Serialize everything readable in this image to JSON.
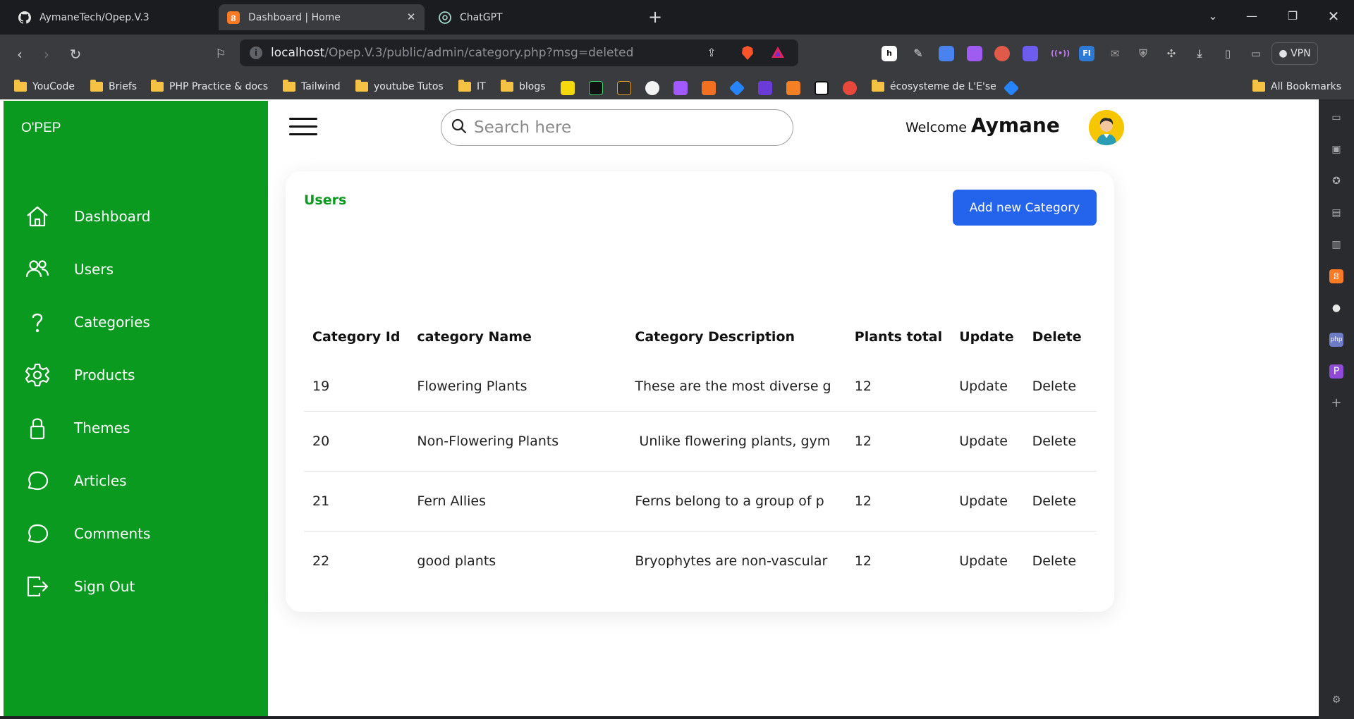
{
  "browser": {
    "tabs": [
      {
        "title": "AymaneTech/Opep.V.3",
        "icon": "github-icon",
        "active": false
      },
      {
        "title": "Dashboard | Home",
        "icon": "xampp-icon",
        "active": true
      },
      {
        "title": "ChatGPT",
        "icon": "chatgpt-icon",
        "active": false
      }
    ],
    "url": {
      "host": "localhost",
      "path": "/Opep.V.3/public/admin/category.php?msg=deleted"
    },
    "vpn_label": "VPN",
    "bookmarks": [
      "YouCode",
      "Briefs",
      "PHP Practice & docs",
      "Tailwind",
      "youtube Tutos",
      "IT",
      "blogs",
      "écosysteme de L'E'se"
    ],
    "all_bookmarks": "All Bookmarks"
  },
  "sidebar": {
    "brand": "O'PEP",
    "items": [
      {
        "label": "Dashboard",
        "icon": "home-icon"
      },
      {
        "label": "Users",
        "icon": "users-icon"
      },
      {
        "label": "Categories",
        "icon": "question-icon"
      },
      {
        "label": "Products",
        "icon": "gear-icon"
      },
      {
        "label": "Themes",
        "icon": "lock-icon"
      },
      {
        "label": "Articles",
        "icon": "chat-bubble-icon"
      },
      {
        "label": "Comments",
        "icon": "chat-bubble-icon"
      },
      {
        "label": "Sign Out",
        "icon": "sign-out-icon"
      }
    ]
  },
  "header": {
    "search_placeholder": "Search here",
    "welcome_text": "Welcome",
    "user_name": "Aymane"
  },
  "card": {
    "title": "Users",
    "add_button": "Add new Category",
    "columns": [
      "Category Id",
      "category Name",
      "Category Description",
      "Plants total",
      "Update",
      "Delete"
    ],
    "rows": [
      {
        "id": "19",
        "name": "Flowering Plants",
        "description": "These are the most diverse g",
        "total": "12",
        "update": "Update",
        "delete": "Delete"
      },
      {
        "id": "20",
        "name": "Non-Flowering Plants",
        "description": " Unlike flowering plants, gym",
        "total": "12",
        "update": "Update",
        "delete": "Delete"
      },
      {
        "id": "21",
        "name": "Fern Allies",
        "description": "Ferns belong to a group of p",
        "total": "12",
        "update": "Update",
        "delete": "Delete"
      },
      {
        "id": "22",
        "name": "good plants",
        "description": "Bryophytes are non-vascular",
        "total": "12",
        "update": "Update",
        "delete": "Delete"
      }
    ]
  },
  "colors": {
    "sidebar": "#0a9a1f",
    "accent_button": "#2463eb",
    "title": "#0a9a1f"
  }
}
